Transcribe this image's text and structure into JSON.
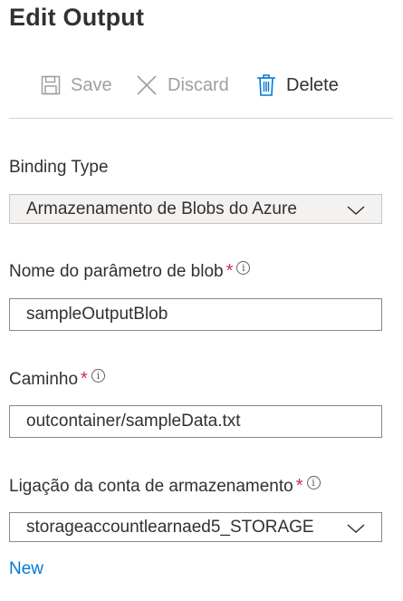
{
  "panel": {
    "title": "Edit Output"
  },
  "toolbar": {
    "save_label": "Save",
    "discard_label": "Discard",
    "delete_label": "Delete"
  },
  "binding_type": {
    "label": "Binding Type",
    "value": "Armazenamento de Blobs do Azure"
  },
  "blob_param": {
    "label": "Nome do parâmetro de blob",
    "required_mark": "*",
    "value": "sampleOutputBlob"
  },
  "path": {
    "label": "Caminho",
    "required_mark": "*",
    "value": "outcontainer/sampleData.txt"
  },
  "storage_connection": {
    "label": "Ligação da conta de armazenamento",
    "required_mark": "*",
    "value": "storageaccountlearnaed5_STORAGE",
    "new_link": "New"
  },
  "colors": {
    "accent": "#0078d4",
    "required": "#c4314b",
    "disabled_text": "#a19f9d",
    "text": "#323130"
  },
  "icons": {
    "save": "save-icon",
    "discard": "close-icon",
    "delete": "trash-icon",
    "info": "info-icon",
    "dropdown": "chevron-down-icon"
  }
}
